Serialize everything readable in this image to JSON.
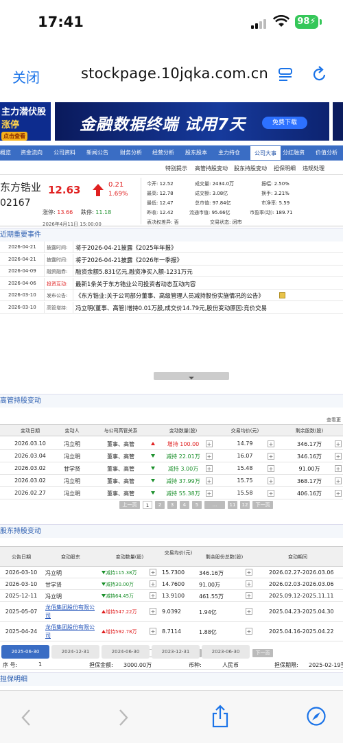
{
  "status_bar": {
    "time": "17:41",
    "battery": "98"
  },
  "browser": {
    "close_label": "关闭",
    "url": "stockpage.10jqka.com.cn"
  },
  "banner": {
    "left_line1": "主力潜伏股",
    "left_line2": "涨停",
    "left_button": "点击查看",
    "main_text": "金融数据终端 试用7天",
    "download_button": "免费下载"
  },
  "nav": {
    "items": [
      "概览",
      "资金流向",
      "公司资料",
      "新闻公告",
      "财务分析",
      "经营分析",
      "股东股本",
      "主力持仓",
      "公司大事",
      "分红融资",
      "价值分析"
    ],
    "active": "公司大事"
  },
  "subnav": {
    "items": [
      "特别提示",
      "高管持股变动",
      "股东持股变动",
      "担保明细",
      "违规处理"
    ]
  },
  "quote": {
    "name": "东方锆业",
    "code": "02167",
    "price": "12.63",
    "change": "0.21",
    "change_pct": "1.69%",
    "limit_up_label": "涨停:",
    "limit_up": "13.66",
    "limit_down_label": "跌停:",
    "limit_down": "11.18",
    "datetime": "2026年4月11日 15:00:00",
    "fields": {
      "open_label": "今开:",
      "open": "12.52",
      "volume_label": "成交量:",
      "volume": "2434.0万",
      "amplitude_label": "振幅:",
      "amplitude": "2.50%",
      "high_label": "最高:",
      "high": "12.78",
      "amount_label": "成交额:",
      "amount": "3.08亿",
      "turnover_label": "换手:",
      "turnover": "3.21%",
      "low_label": "最低:",
      "low": "12.47",
      "total_mv_label": "总市值:",
      "total_mv": "97.84亿",
      "pb_label": "市净率:",
      "pb": "5.59",
      "prev_label": "昨收:",
      "prev": "12.42",
      "float_mv_label": "流通市值:",
      "float_mv": "95.66亿",
      "pe_label": "市盈率(动):",
      "pe": "189.71",
      "voting_label": "表决权差异:",
      "voting": "否",
      "trade_status_label": "交易状态:",
      "trade_status": "闭市"
    }
  },
  "events": {
    "title": "近期重要事件",
    "rows": [
      {
        "date": "2026-04-21",
        "type": "披露时间:",
        "text": "将于2026-04-21披露《2025年年报》"
      },
      {
        "date": "2026-04-21",
        "type": "披露时间:",
        "text": "将于2026-04-21披露《2026年一季报》"
      },
      {
        "date": "2026-04-09",
        "type": "融资融券:",
        "text": "融资余额5.831亿元,融资净买入额-1231万元"
      },
      {
        "date": "2026-04-06",
        "type": "投资互动:",
        "text": "最新1条关于东方锆业公司投资者动态互动内容"
      },
      {
        "date": "2026-03-10",
        "type": "发布公告:",
        "text": "《东方锆业:关于公司部分董事、高级管理人员减持股份实施情况的公告》"
      },
      {
        "date": "2026-03-10",
        "type": "高管增持:",
        "text": "冯立明(董事、高管)增持0.01万股,成交价14.79元,股份变动原因:竞价交易"
      }
    ]
  },
  "exec": {
    "title": "高管持股变动",
    "more": "查看更",
    "headers": [
      "变动日期",
      "变动人",
      "与公司高管关系",
      "变动数量(股)",
      "交易均价(元)",
      "剩余股数(股)"
    ],
    "rows": [
      {
        "date": "2026.03.10",
        "person": "冯立明",
        "rel": "董事、高管",
        "dir": "up",
        "qty": "增持 100.00",
        "price": "14.79",
        "remain": "346.17万"
      },
      {
        "date": "2026.03.04",
        "person": "冯立明",
        "rel": "董事、高管",
        "dir": "down",
        "qty": "减持 22.01万",
        "price": "16.07",
        "remain": "346.16万"
      },
      {
        "date": "2026.03.02",
        "person": "甘学贤",
        "rel": "董事、高管",
        "dir": "down",
        "qty": "减持 3.00万",
        "price": "15.48",
        "remain": "91.00万"
      },
      {
        "date": "2026.03.02",
        "person": "冯立明",
        "rel": "董事、高管",
        "dir": "down",
        "qty": "减持 37.99万",
        "price": "15.75",
        "remain": "368.17万"
      },
      {
        "date": "2026.02.27",
        "person": "冯立明",
        "rel": "董事、高管",
        "dir": "down",
        "qty": "减持 55.38万",
        "price": "15.58",
        "remain": "406.16万"
      }
    ],
    "pager": [
      "上一页",
      "1",
      "2",
      "3",
      "4",
      "5",
      "...",
      "11",
      "12",
      "下一页"
    ]
  },
  "holders": {
    "title": "股东持股变动",
    "headers": [
      "公告日期",
      "变动股东",
      "变动数量(股)",
      "交易均价(元)",
      "剩余股份总数(股)",
      "变动期间"
    ],
    "rows": [
      {
        "date": "2026-03-10",
        "holder": "冯立明",
        "dir": "down",
        "qty": "减持115.38万",
        "price": "15.7300",
        "remain": "346.16万",
        "period": "2026.02.27-2026.03.06",
        "link": false
      },
      {
        "date": "2026-03-10",
        "holder": "甘学贤",
        "dir": "down",
        "qty": "减持30.00万",
        "price": "14.7600",
        "remain": "91.00万",
        "period": "2026.02.03-2026.03.06",
        "link": false
      },
      {
        "date": "2025-12-11",
        "holder": "冯立明",
        "dir": "down",
        "qty": "减持64.45万",
        "price": "13.9100",
        "remain": "461.55万",
        "period": "2025.09.12-2025.11.11",
        "link": false
      },
      {
        "date": "2025-05-07",
        "holder": "龙佰集团股份有限公司",
        "dir": "up",
        "qty": "增持547.22万",
        "price": "9.0392",
        "remain": "1.94亿",
        "period": "2025.04.23-2025.04.30",
        "link": true
      },
      {
        "date": "2025-04-24",
        "holder": "龙佰集团股份有限公司",
        "dir": "up",
        "qty": "增持592.78万",
        "price": "8.7114",
        "remain": "1.88亿",
        "period": "2025.04.16-2025.04.22",
        "link": true
      }
    ],
    "pager": [
      "上一页",
      "1",
      "2",
      "3",
      "4",
      "5",
      "...",
      "10",
      "11",
      "下一页"
    ]
  },
  "guarantee": {
    "title": "担保明细",
    "tabs": [
      "2025-06-30",
      "2024-12-31",
      "2024-06-30",
      "2023-12-31",
      "2023-06-30"
    ],
    "row": {
      "seq_label": "序 号:",
      "seq": "1",
      "amount_label": "担保金额:",
      "amount": "3000.00万",
      "currency_label": "币种:",
      "currency": "人民币",
      "period_label": "担保期限:",
      "period": "2025-02-19至"
    }
  },
  "colors": {
    "accent": "#1a73e8",
    "nav_blue": "#3a6dc4",
    "up_red": "#e02020",
    "down_green": "#1a8f2a"
  },
  "icons": [
    "signal-icon",
    "wifi-icon",
    "battery-icon",
    "reader-icon",
    "reload-icon",
    "back-icon",
    "forward-icon",
    "share-icon",
    "compass-icon"
  ]
}
